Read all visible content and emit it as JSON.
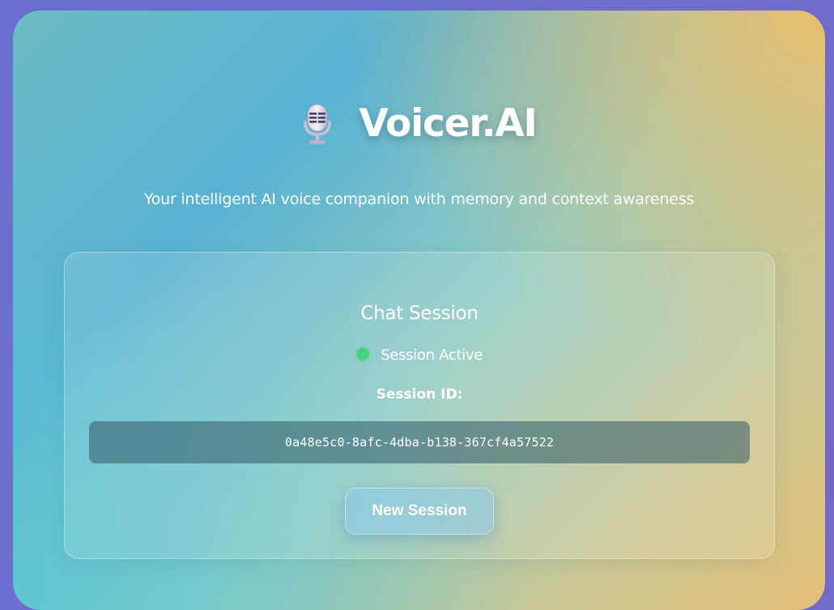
{
  "header": {
    "title": "Voicer.AI",
    "icon": "microphone-icon",
    "subtitle": "Your intelligent AI voice companion with memory and context awareness"
  },
  "session": {
    "heading": "Chat Session",
    "status": {
      "label": "Session Active",
      "color": "#47d27e"
    },
    "id_label": "Session ID:",
    "id_value": "0a48e5c0-8afc-4dba-b138-367cf4a57522",
    "new_session_label": "New Session"
  },
  "colors": {
    "gradient_start": "#58b2d2",
    "gradient_end": "#e4bf76",
    "page_background": "#6a6fcf"
  }
}
